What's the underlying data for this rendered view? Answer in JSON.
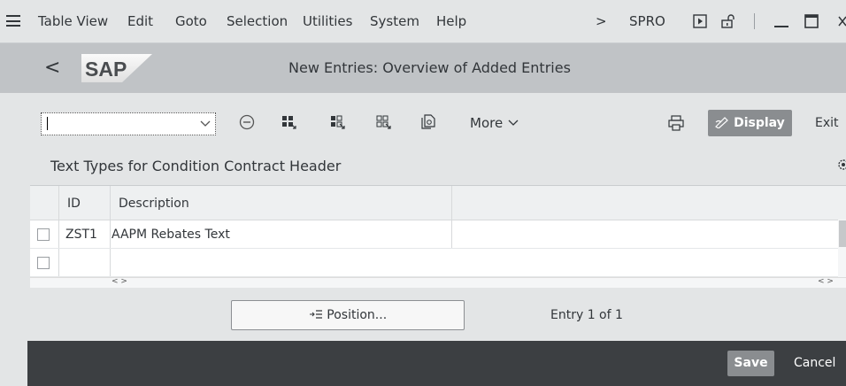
{
  "menubar": {
    "items": [
      "Table View",
      "Edit",
      "Goto",
      "Selection",
      "Utilities",
      "System",
      "Help"
    ],
    "overflow_glyph": ">",
    "tcode": "SPRO"
  },
  "titlebar": {
    "back_glyph": "<",
    "logo_text": "SAP",
    "title": "New Entries: Overview of Added Entries"
  },
  "toolbar": {
    "more_label": "More",
    "display_label": "Display",
    "exit_label": "Exit"
  },
  "section": {
    "title": "Text Types for Condition Contract Header"
  },
  "table": {
    "columns": [
      "ID",
      "Description"
    ],
    "rows": [
      {
        "id": "ZST1",
        "description": "AAPM Rebates Text"
      },
      {
        "id": "",
        "description": ""
      }
    ],
    "hscroll_glyph": "< >"
  },
  "position_button_label": "Position...",
  "entry_status": "Entry 1 of 1",
  "footer": {
    "save_label": "Save",
    "cancel_label": "Cancel"
  },
  "colors": {
    "shell": "#e3e5e6",
    "titlebar": "#c0c3c6",
    "footer": "#3c3f42",
    "primary_button": "#8a8d90"
  }
}
